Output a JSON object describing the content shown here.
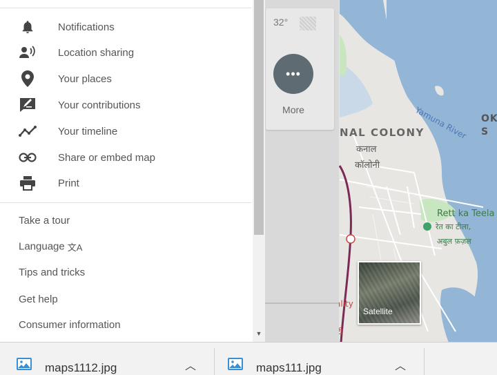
{
  "menu": {
    "primary_items": [
      {
        "label": "Notifications",
        "icon": "bell-icon"
      },
      {
        "label": "Location sharing",
        "icon": "location-sharing-icon"
      },
      {
        "label": "Your places",
        "icon": "map-pin-icon"
      },
      {
        "label": "Your contributions",
        "icon": "contributions-icon"
      },
      {
        "label": "Your timeline",
        "icon": "timeline-icon"
      },
      {
        "label": "Share or embed map",
        "icon": "link-icon"
      },
      {
        "label": "Print",
        "icon": "printer-icon"
      }
    ],
    "secondary_items": [
      {
        "label": "Take a tour"
      },
      {
        "label": "Language",
        "icon": "translate-icon"
      },
      {
        "label": "Tips and tricks"
      },
      {
        "label": "Get help"
      },
      {
        "label": "Consumer information"
      }
    ]
  },
  "weather": {
    "temperature": "32°"
  },
  "more_button": {
    "label": "More",
    "glyph": "•••"
  },
  "map": {
    "labels": {
      "colony_en": "NAL COLONY",
      "colony_hi_1": "कनाल",
      "colony_hi_2": "कॉलोनी",
      "river": "Yamuna River",
      "ok": "OK\nS",
      "rett_en": "Rett ka Teela",
      "rett_hi_1": "रेत का टीला,",
      "rett_hi_2": "अबुल फ़ज़ल",
      "ality": "ality",
      "ality_hi": "टी"
    },
    "satellite_label": "Satellite",
    "colors": {
      "water": "#93b5d6",
      "land": "#e8e6e2",
      "park": "#c8e6c0",
      "rail": "#7a2a54"
    }
  },
  "downloads": [
    {
      "filename": "maps1112.jpg"
    },
    {
      "filename": "maps111.jpg"
    }
  ]
}
